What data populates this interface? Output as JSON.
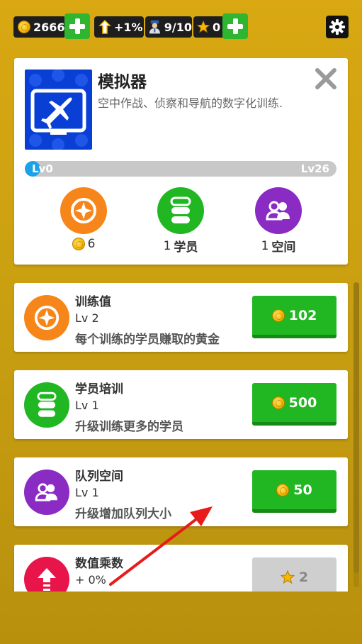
{
  "topbar": {
    "coins": "2666",
    "boost": "+1%",
    "students": "9/10",
    "stars": "0"
  },
  "header": {
    "title": "模拟器",
    "description": "空中作战、侦察和导航的数字化训练.",
    "level_min": "Lv0",
    "level_max": "Lv26",
    "level_progress": 0.05,
    "stats": [
      {
        "value": "6",
        "label": ""
      },
      {
        "value": "1",
        "label": "学员"
      },
      {
        "value": "1",
        "label": "空间"
      }
    ]
  },
  "upgrades": [
    {
      "title": "训练值",
      "level": "Lv 2",
      "desc": "每个训练的学员赚取的黄金",
      "price": "102",
      "currency": "coin",
      "enabled": true
    },
    {
      "title": "学员培训",
      "level": "Lv 1",
      "desc": "升级训练更多的学员",
      "price": "500",
      "currency": "coin",
      "enabled": true
    },
    {
      "title": "队列空间",
      "level": "Lv 1",
      "desc": "升级增加队列大小",
      "price": "50",
      "currency": "coin",
      "enabled": true
    },
    {
      "title": "数值乘数",
      "level": "+ 0%",
      "desc": "",
      "price": "2",
      "currency": "star",
      "enabled": false
    }
  ],
  "colors": {
    "orange": "#f7861a",
    "green": "#20b722",
    "purple": "#8a2bc4",
    "red": "#e8154a",
    "blue": "#0a3fd6",
    "progress": "#1aa1e8"
  }
}
